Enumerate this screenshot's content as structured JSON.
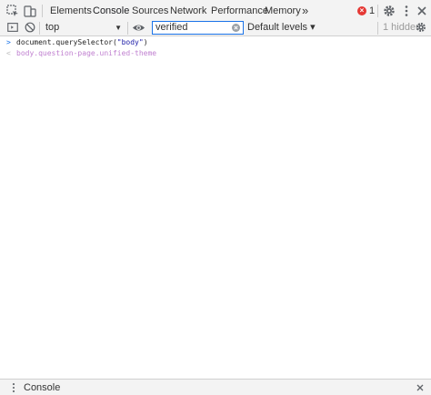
{
  "tabbar": {
    "tabs": [
      {
        "label": "Elements"
      },
      {
        "label": "Console"
      },
      {
        "label": "Sources"
      },
      {
        "label": "Network"
      },
      {
        "label": "Performance"
      },
      {
        "label": "Memory"
      }
    ],
    "overflow_label": "»",
    "error_count": "1"
  },
  "toolbar": {
    "context": "top",
    "filter_value": "verified",
    "levels_label": "Default levels ▾",
    "hidden_count": "1 hidden"
  },
  "console": {
    "command_prefix": "document.querySelector(",
    "command_string": "\"body\"",
    "command_suffix": ")",
    "result": "body.question-page.unified-theme"
  },
  "drawer": {
    "tab_label": "Console"
  },
  "colors": {
    "accent": "#1a73e8",
    "error": "#e53935",
    "result_text": "#c080d0"
  }
}
